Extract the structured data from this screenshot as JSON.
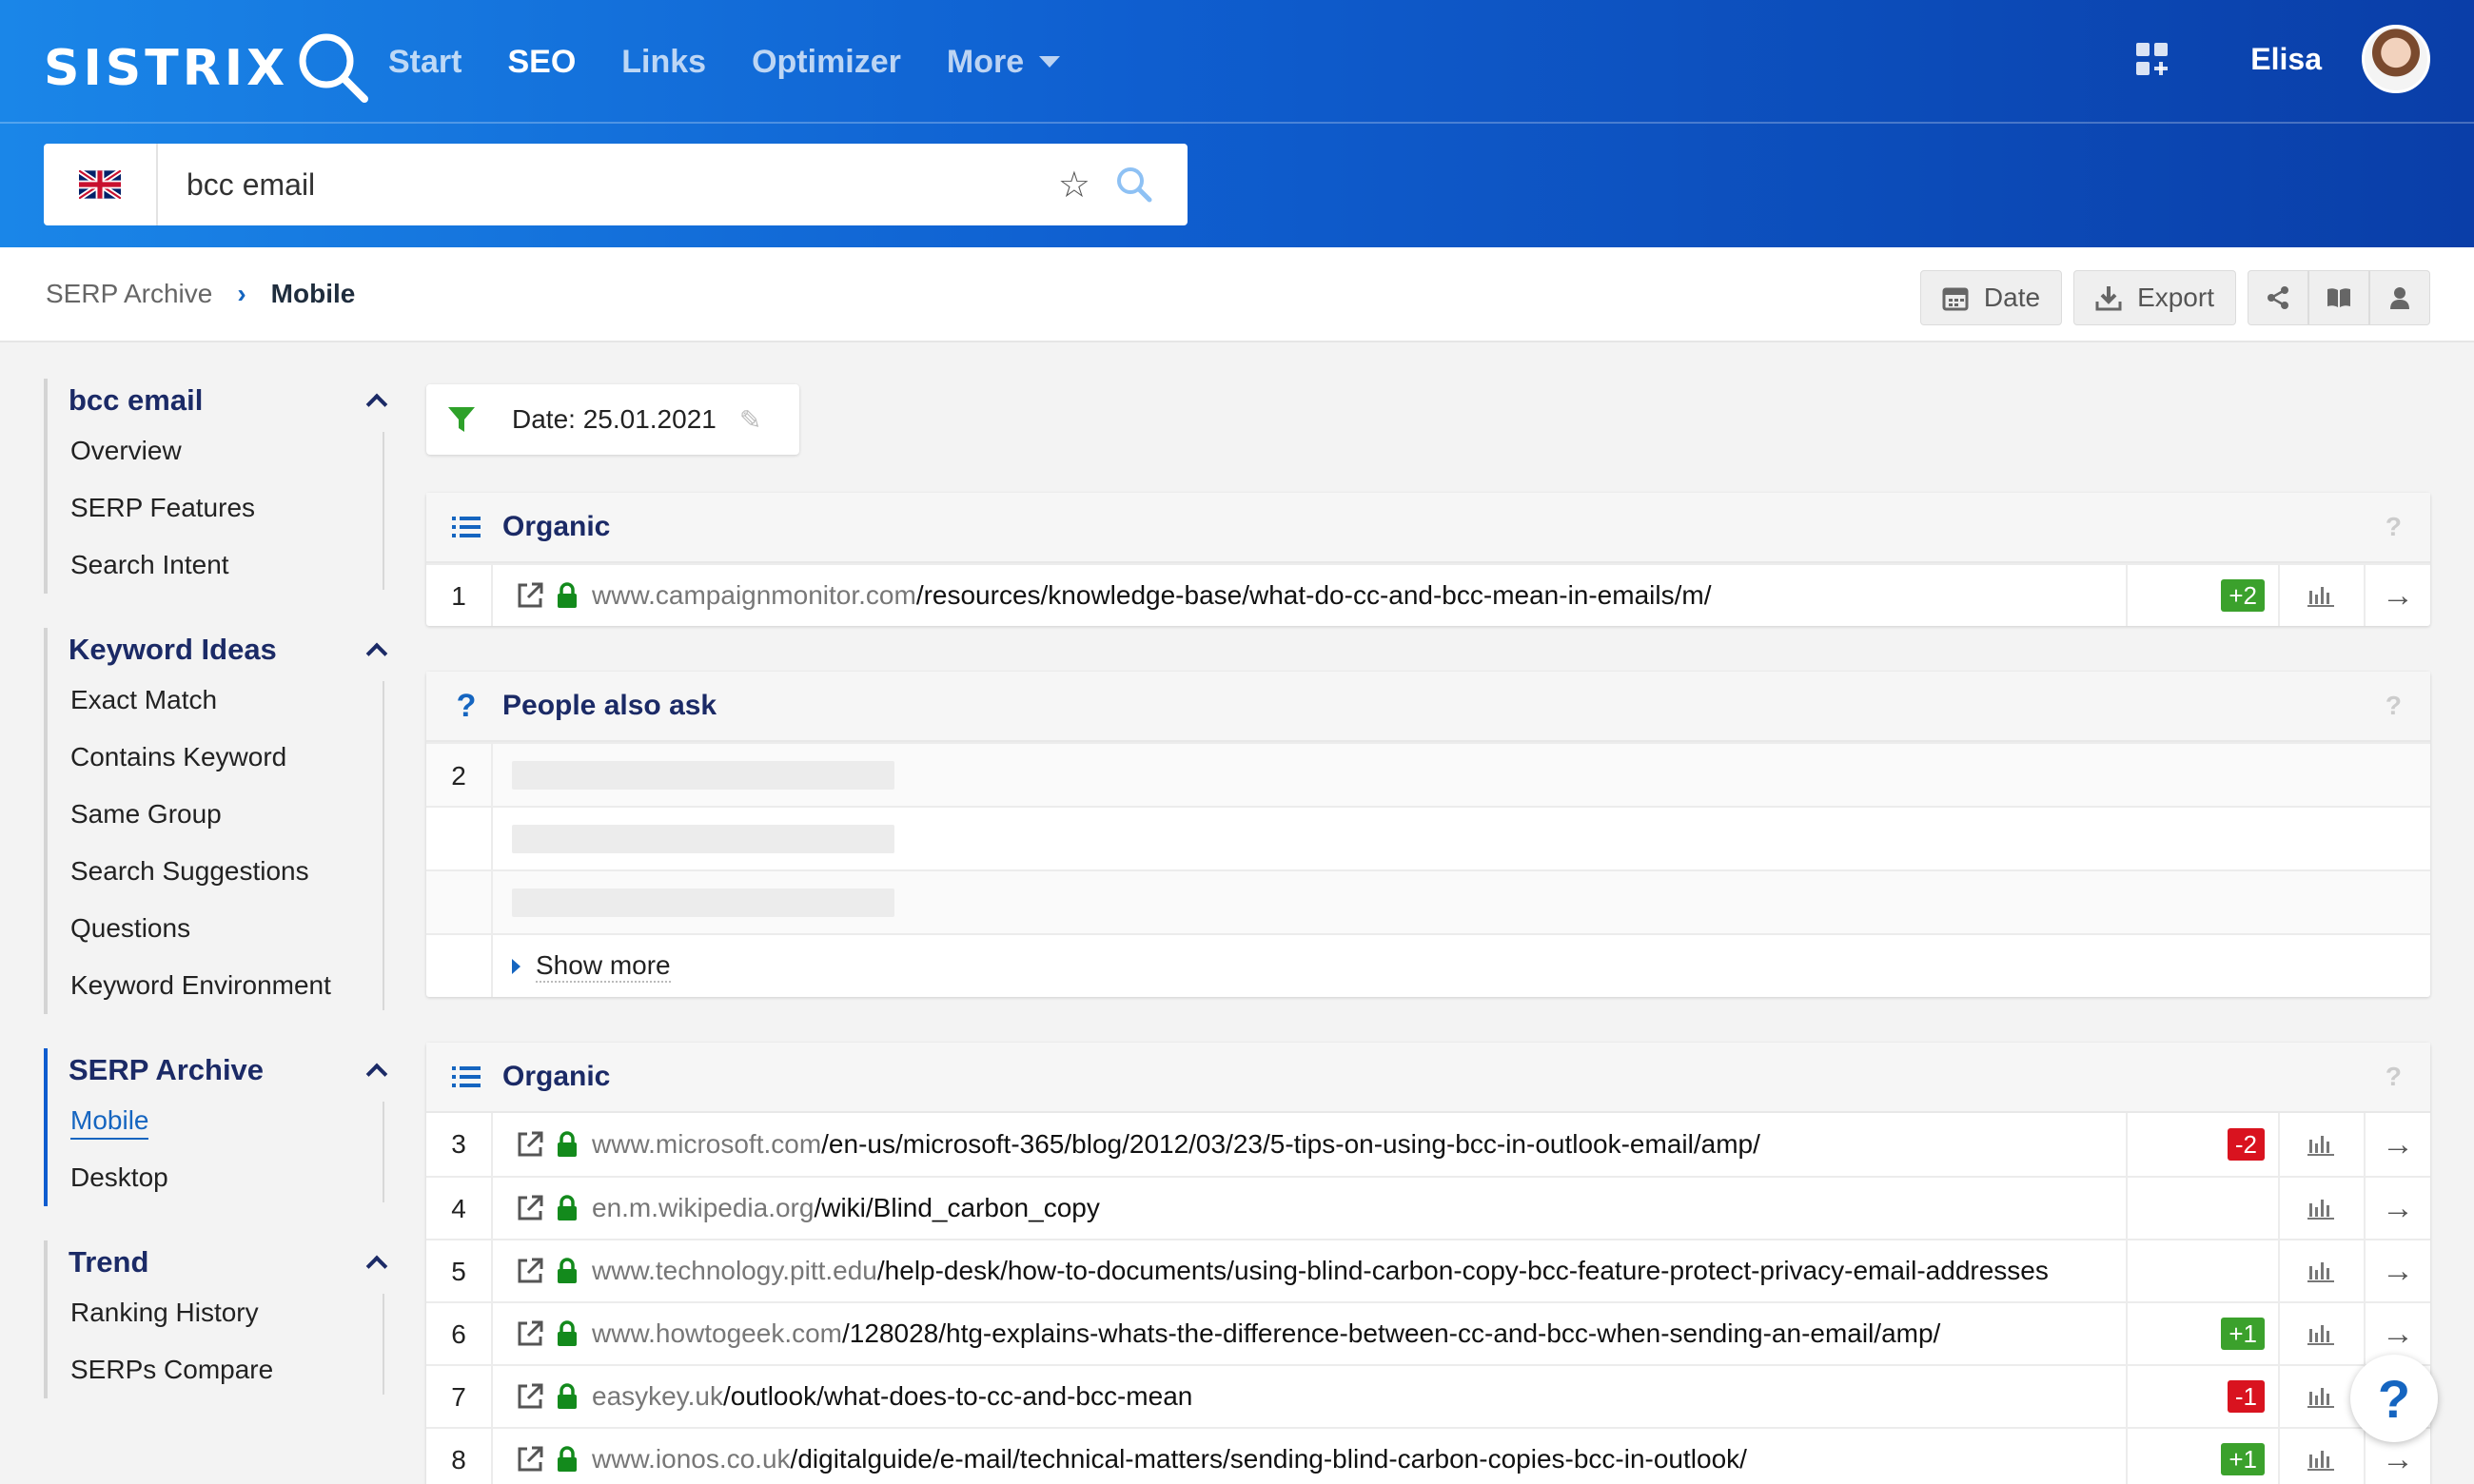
{
  "header": {
    "logo": "SISTRIX",
    "nav": [
      "Start",
      "SEO",
      "Links",
      "Optimizer",
      "More"
    ],
    "active_nav": "SEO",
    "user": "Elisa"
  },
  "search": {
    "value": "bcc email",
    "country": "UK"
  },
  "breadcrumb": {
    "parent": "SERP Archive",
    "current": "Mobile"
  },
  "toolbar": {
    "date": "Date",
    "export": "Export"
  },
  "sidebar": {
    "groups": [
      {
        "title": "bcc email",
        "items": [
          "Overview",
          "SERP Features",
          "Search Intent"
        ]
      },
      {
        "title": "Keyword Ideas",
        "items": [
          "Exact Match",
          "Contains Keyword",
          "Same Group",
          "Search Suggestions",
          "Questions",
          "Keyword Environment"
        ]
      },
      {
        "title": "SERP Archive",
        "items": [
          "Mobile",
          "Desktop"
        ]
      },
      {
        "title": "Trend",
        "items": [
          "Ranking History",
          "SERPs Compare"
        ]
      }
    ]
  },
  "filter": {
    "date": "Date: 25.01.2021"
  },
  "panels": {
    "organic1": {
      "title": "Organic",
      "help": "?",
      "rows": [
        {
          "pos": "1",
          "host": "www.campaignmonitor.com",
          "path": "/resources/knowledge-base/what-do-cc-and-bcc-mean-in-emails/m/",
          "change": "+2",
          "dir": "up"
        }
      ]
    },
    "paa": {
      "title": "People also ask",
      "help": "?",
      "position": "2",
      "show_more": "Show more"
    },
    "organic2": {
      "title": "Organic",
      "help": "?",
      "rows": [
        {
          "pos": "3",
          "host": "www.microsoft.com",
          "path": "/en-us/microsoft-365/blog/2012/03/23/5-tips-on-using-bcc-in-outlook-email/amp/",
          "change": "-2",
          "dir": "down"
        },
        {
          "pos": "4",
          "host": "en.m.wikipedia.org",
          "path": "/wiki/Blind_carbon_copy",
          "change": "",
          "dir": ""
        },
        {
          "pos": "5",
          "host": "www.technology.pitt.edu",
          "path": "/help-desk/how-to-documents/using-blind-carbon-copy-bcc-feature-protect-privacy-email-addresses",
          "change": "",
          "dir": ""
        },
        {
          "pos": "6",
          "host": "www.howtogeek.com",
          "path": "/128028/htg-explains-whats-the-difference-between-cc-and-bcc-when-sending-an-email/amp/",
          "change": "+1",
          "dir": "up"
        },
        {
          "pos": "7",
          "host": "easykey.uk",
          "path": "/outlook/what-does-to-cc-and-bcc-mean",
          "change": "-1",
          "dir": "down"
        },
        {
          "pos": "8",
          "host": "www.ionos.co.uk",
          "path": "/digitalguide/e-mail/technical-matters/sending-blind-carbon-copies-bcc-in-outlook/",
          "change": "+1",
          "dir": "up"
        }
      ]
    }
  },
  "fab": "?"
}
